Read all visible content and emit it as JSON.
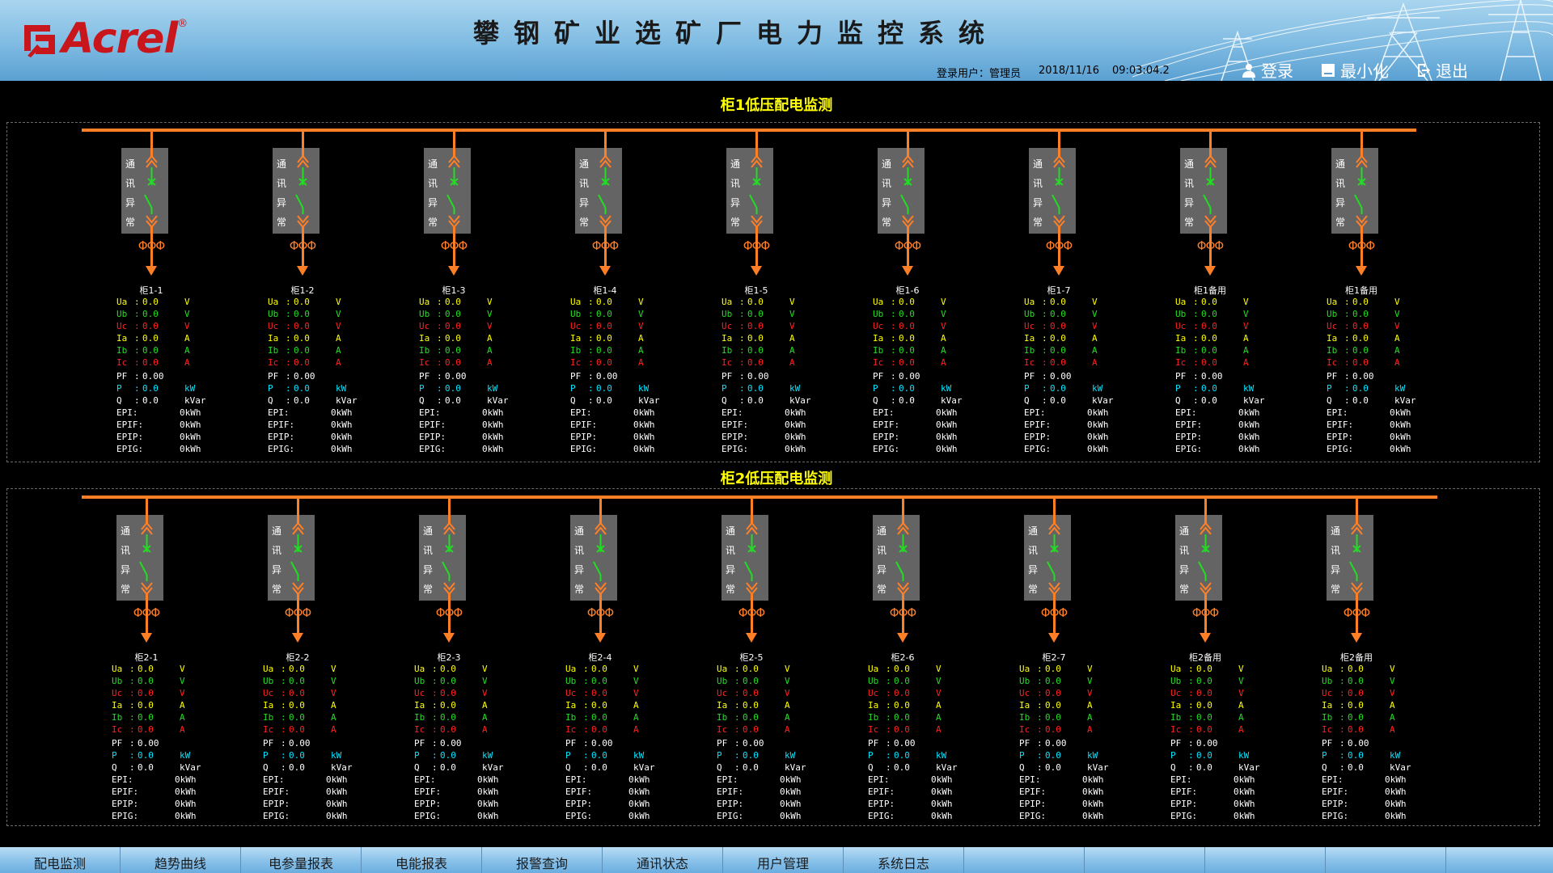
{
  "header": {
    "brand": "Acrel",
    "brand_mark": "®",
    "title": "攀钢矿业选矿厂电力监控系统",
    "login_user_label": "登录用户：",
    "login_user": "管理员",
    "date": "2018/11/16",
    "time": "09:03:04.2",
    "buttons": {
      "login": "登录",
      "minimize": "最小化",
      "exit": "退出"
    }
  },
  "cabinet_label": [
    "通",
    "讯",
    "异",
    "常"
  ],
  "phi_symbol": "ΦΦΦ",
  "field_labels": {
    "ua": "Ua",
    "ub": "Ub",
    "uc": "Uc",
    "ia": "Ia",
    "ib": "Ib",
    "ic": "Ic",
    "pf": "PF",
    "p": "P",
    "q": "Q",
    "epi": "EPI:",
    "epif": "EPIF:",
    "epip": "EPIP:",
    "epig": "EPIG:"
  },
  "units": {
    "v": "V",
    "a": "A",
    "kw": "kW",
    "kvar": "kVar",
    "kwh": "kWh"
  },
  "panels": [
    {
      "title": "柜1低压配电监测",
      "feeders": [
        {
          "name": "柜1-1"
        },
        {
          "name": "柜1-2"
        },
        {
          "name": "柜1-3"
        },
        {
          "name": "柜1-4"
        },
        {
          "name": "柜1-5"
        },
        {
          "name": "柜1-6"
        },
        {
          "name": "柜1-7"
        },
        {
          "name": "柜1备用"
        },
        {
          "name": "柜1备用"
        }
      ]
    },
    {
      "title": "柜2低压配电监测",
      "feeders": [
        {
          "name": "柜2-1"
        },
        {
          "name": "柜2-2"
        },
        {
          "name": "柜2-3"
        },
        {
          "name": "柜2-4"
        },
        {
          "name": "柜2-5"
        },
        {
          "name": "柜2-6"
        },
        {
          "name": "柜2-7"
        },
        {
          "name": "柜2备用"
        },
        {
          "name": "柜2备用"
        }
      ]
    }
  ],
  "readings": {
    "ua": "0.0",
    "ub": "0.0",
    "uc": "0.0",
    "ia": "0.0",
    "ib": "0.0",
    "ic": "0.0",
    "pf": "0.00",
    "p": "0.0",
    "q": "0.0",
    "epi": "0",
    "epif": "0",
    "epip": "0",
    "epig": "0"
  },
  "colors": {
    "busbar": "#ff7f27",
    "switch_closed": "#22dd22",
    "title": "#ffff00"
  },
  "nav": [
    "配电监测",
    "趋势曲线",
    "电参量报表",
    "电能报表",
    "报警查询",
    "通讯状态",
    "用户管理",
    "系统日志",
    "",
    "",
    "",
    ""
  ]
}
